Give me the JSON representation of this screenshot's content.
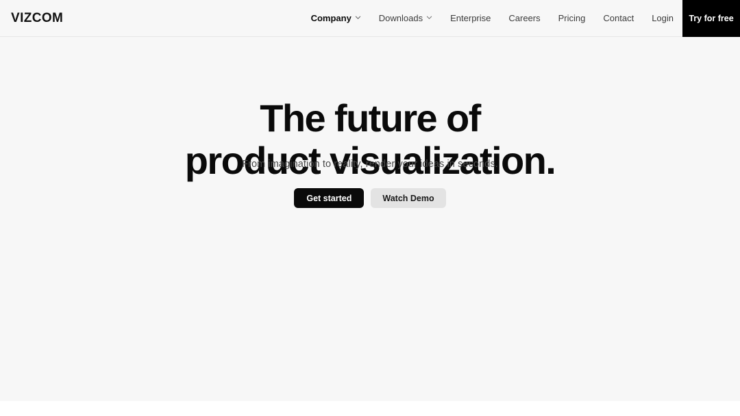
{
  "brand": {
    "logo_text": "VIZCOM",
    "accent_color": "#0a0a0a",
    "hero_background": "#f7f7f7",
    "page_background": "#ffffff"
  },
  "header": {
    "nav_items": [
      {
        "label": "Company",
        "has_dropdown": true,
        "icon": "chevron-down-icon",
        "active": true
      },
      {
        "label": "Downloads",
        "has_dropdown": true,
        "icon": "chevron-down-icon",
        "active": false
      },
      {
        "label": "Enterprise",
        "has_dropdown": false,
        "icon": "",
        "active": false
      },
      {
        "label": "Careers",
        "has_dropdown": false,
        "icon": "",
        "active": false
      },
      {
        "label": "Pricing",
        "has_dropdown": false,
        "icon": "",
        "active": false
      },
      {
        "label": "Contact",
        "has_dropdown": false,
        "icon": "",
        "active": false
      },
      {
        "label": "Login",
        "has_dropdown": false,
        "icon": "",
        "active": false
      }
    ],
    "cta_label": "Try for free"
  },
  "hero": {
    "headline_line_1": "The future of",
    "headline_line_2": "product visualization.",
    "subtitle": "From imagination to reality, render your ideas in seconds.",
    "primary_button": "Get started",
    "secondary_button": "Watch Demo"
  }
}
